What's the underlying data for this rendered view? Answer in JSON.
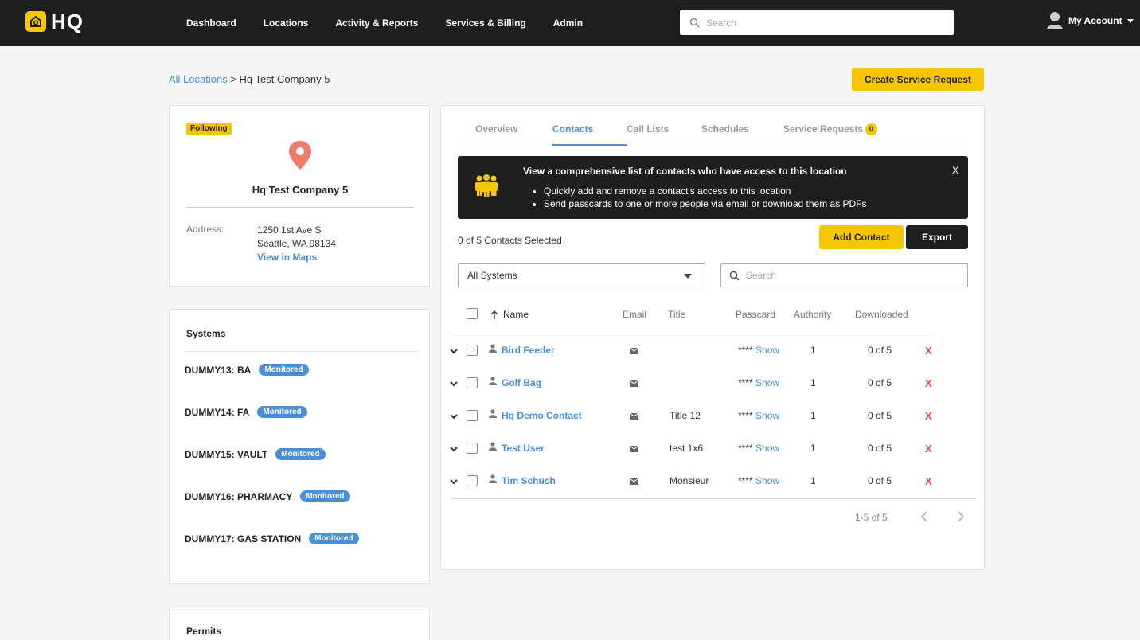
{
  "header": {
    "logo_text": "HQ",
    "nav": [
      "Dashboard",
      "Locations",
      "Activity & Reports",
      "Services & Billing",
      "Admin"
    ],
    "search_placeholder": "Search",
    "account_label": "My Account"
  },
  "breadcrumb": {
    "root": "All Locations",
    "separator": " > ",
    "current": "Hq Test Company 5"
  },
  "actions": {
    "create_service_request": "Create Service Request"
  },
  "location": {
    "follow_badge": "Following",
    "name": "Hq Test Company 5",
    "address_label": "Address:",
    "address_line1": "1250 1st Ave S",
    "address_line2": "Seattle, WA 98134",
    "maps_link": "View in Maps"
  },
  "systems": {
    "title": "Systems",
    "items": [
      {
        "name": "DUMMY13: BA",
        "status": "Monitored"
      },
      {
        "name": "DUMMY14: FA",
        "status": "Monitored"
      },
      {
        "name": "DUMMY15: VAULT",
        "status": "Monitored"
      },
      {
        "name": "DUMMY16: PHARMACY",
        "status": "Monitored"
      },
      {
        "name": "DUMMY17: GAS STATION",
        "status": "Monitored"
      }
    ]
  },
  "permits": {
    "title": "Permits"
  },
  "tabs": {
    "items": [
      "Overview",
      "Contacts",
      "Call Lists",
      "Schedules",
      "Service Requests"
    ],
    "active": "Contacts",
    "service_requests_count": "0"
  },
  "banner": {
    "title": "View a comprehensive list of contacts who have access to this location",
    "bullets": [
      "Quickly add and remove a contact's access to this location",
      "Send passcards to one or more people via email or download them as PDFs"
    ],
    "close": "X"
  },
  "contacts": {
    "selected_text": "0 of 5 Contacts Selected",
    "add_label": "Add Contact",
    "export_label": "Export",
    "system_filter": "All Systems",
    "search_placeholder": "Search",
    "columns": {
      "name": "Name",
      "email": "Email",
      "title": "Title",
      "passcard": "Passcard",
      "authority": "Authority",
      "downloaded": "Downloaded"
    },
    "rows": [
      {
        "name": "Bird Feeder",
        "title": "",
        "passcard_mask": "****",
        "passcard_action": "Show",
        "authority": "1",
        "downloaded": "0 of 5",
        "delete": "X"
      },
      {
        "name": "Golf Bag",
        "title": "",
        "passcard_mask": "****",
        "passcard_action": "Show",
        "authority": "1",
        "downloaded": "0 of 5",
        "delete": "X"
      },
      {
        "name": "Hq Demo Contact",
        "title": "Title 12",
        "passcard_mask": "****",
        "passcard_action": "Show",
        "authority": "1",
        "downloaded": "0 of 5",
        "delete": "X"
      },
      {
        "name": "Test User",
        "title": "test 1x6",
        "passcard_mask": "****",
        "passcard_action": "Show",
        "authority": "1",
        "downloaded": "0 of 5",
        "delete": "X"
      },
      {
        "name": "Tim Schuch",
        "title": "Monsieur",
        "passcard_mask": "****",
        "passcard_action": "Show",
        "authority": "1",
        "downloaded": "0 of 5",
        "delete": "X"
      }
    ],
    "pagination": "1-5 of 5"
  },
  "colors": {
    "brand_yellow": "#f7c600",
    "link_blue": "#4a90d9",
    "dark": "#1e1e1e",
    "delete_red": "#e74c3c"
  }
}
